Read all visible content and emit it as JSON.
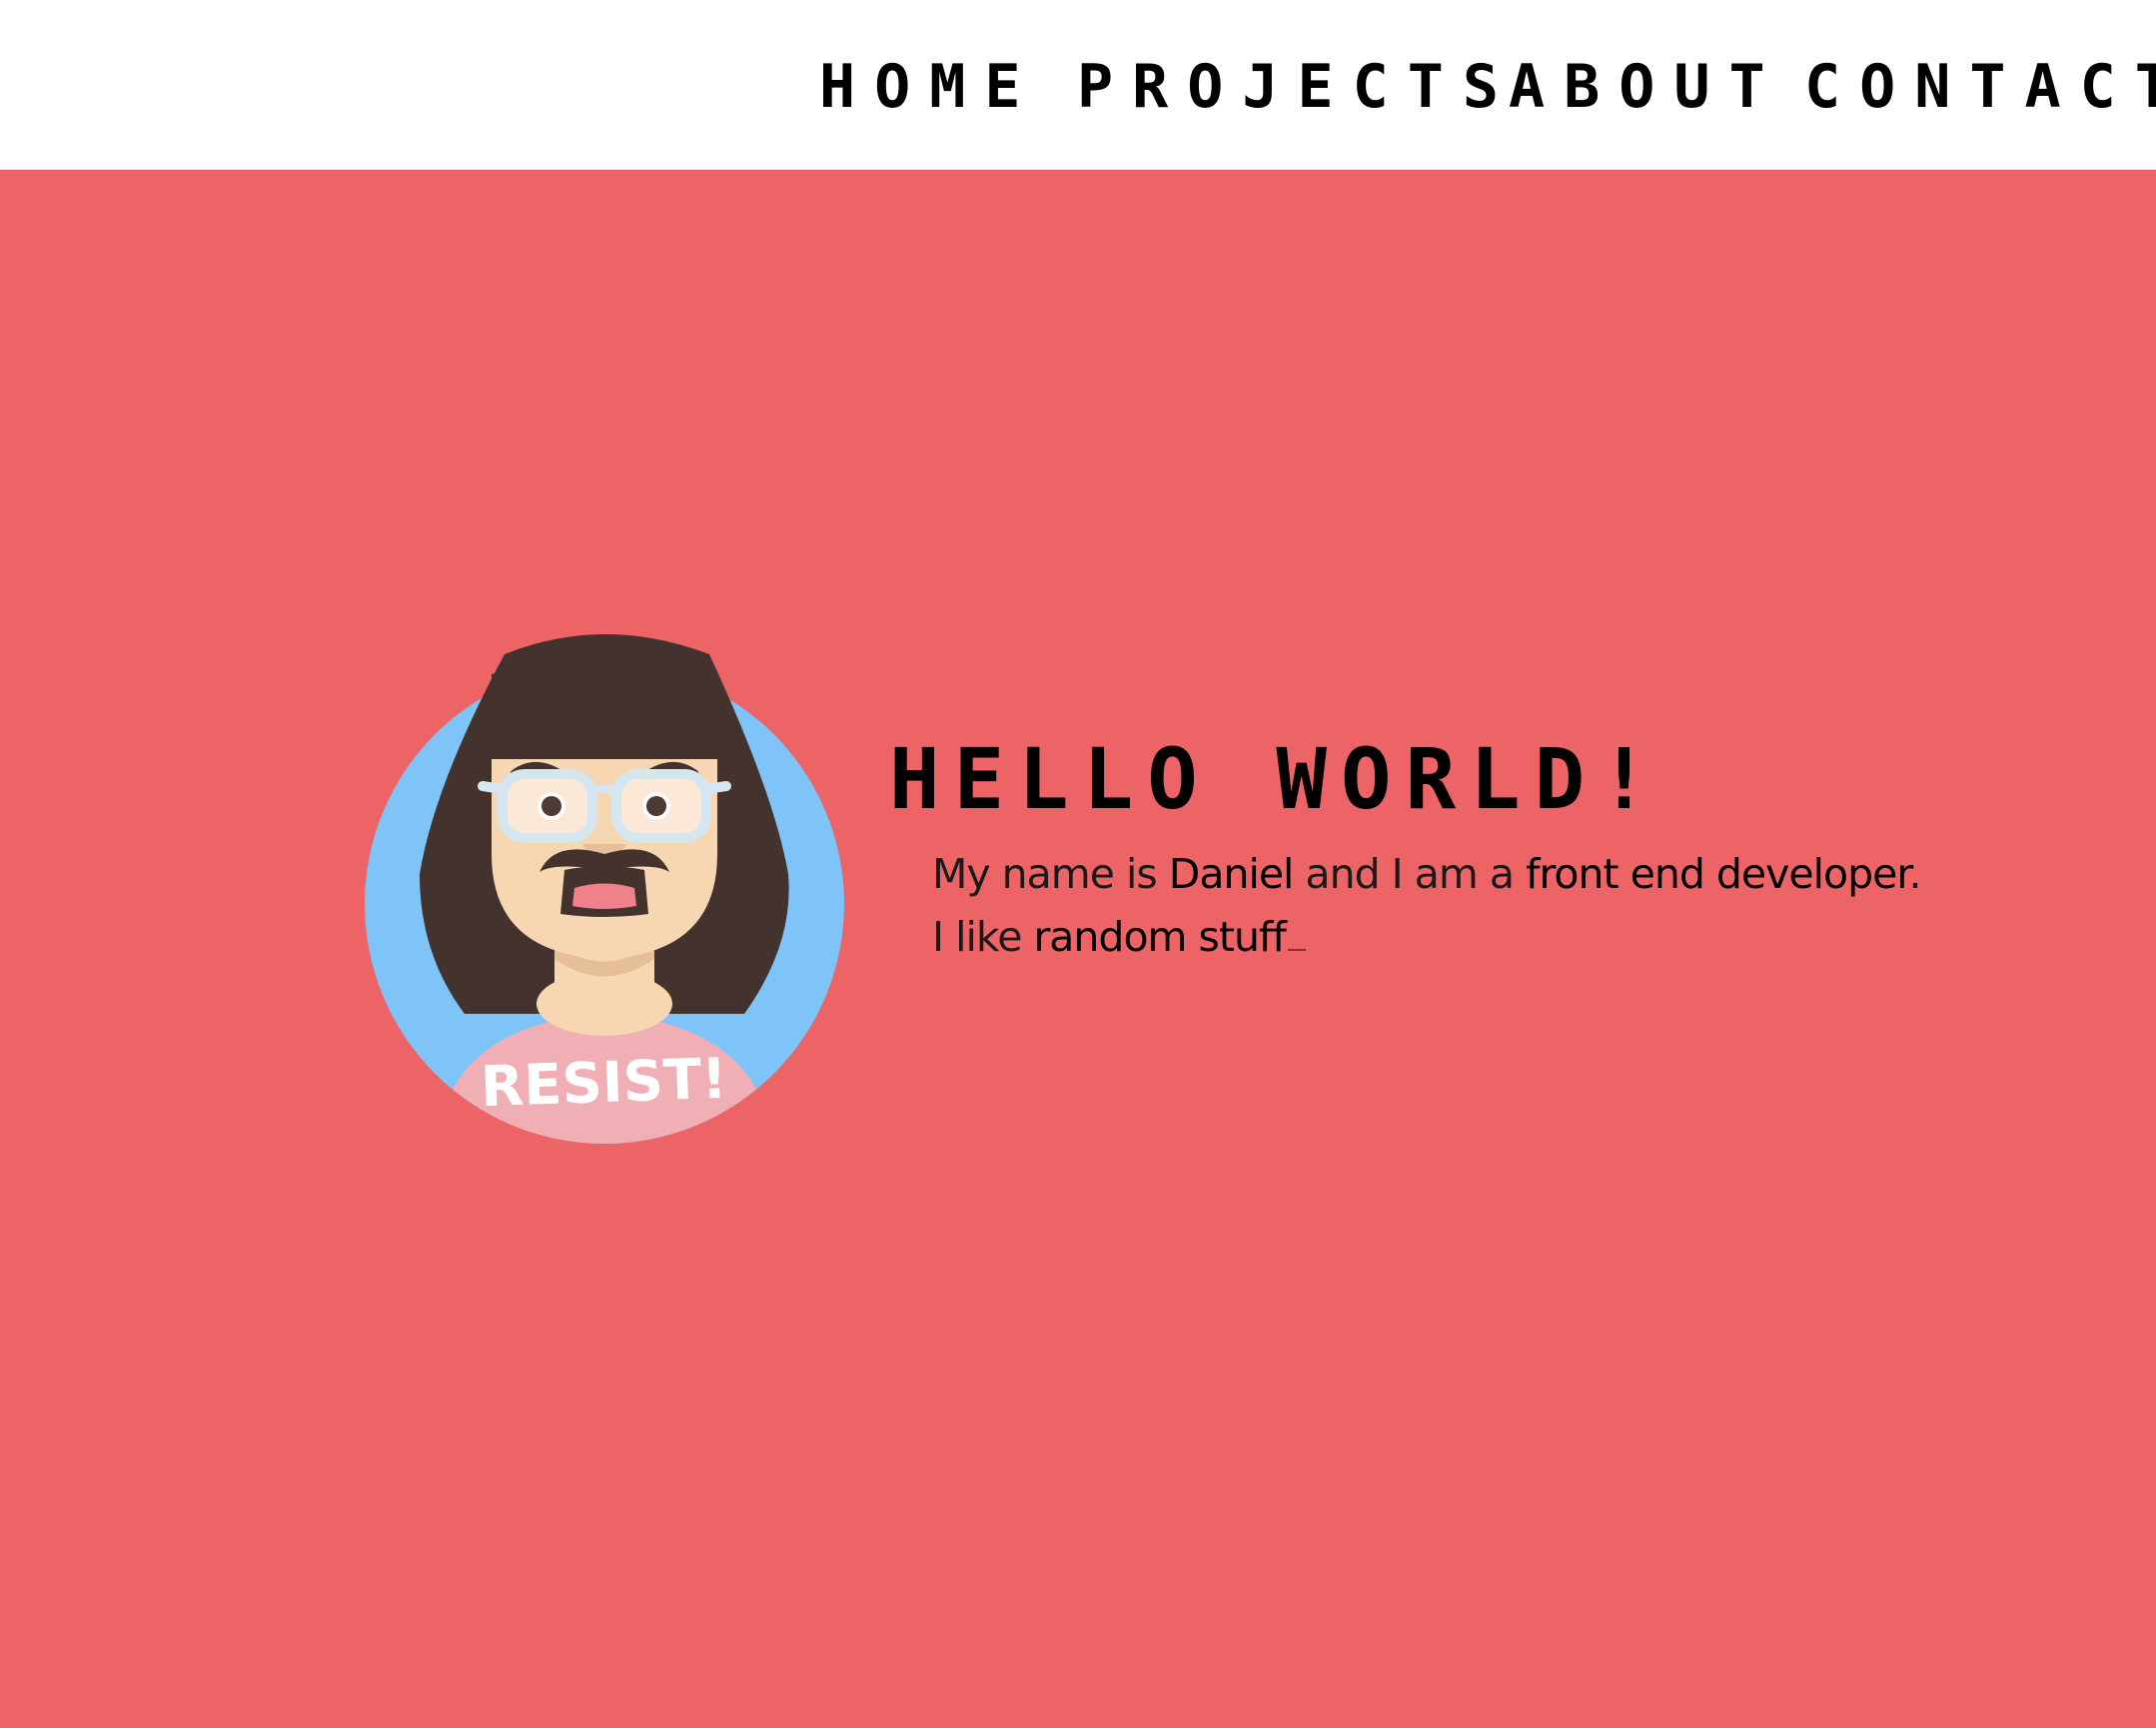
{
  "nav": {
    "items": [
      {
        "label": "HOME"
      },
      {
        "label": "PROJECTS"
      },
      {
        "label": "ABOUT"
      },
      {
        "label": "CONTACT"
      }
    ]
  },
  "hero": {
    "greeting": "HELLO WORLD!",
    "line1": {
      "part1": "My name is ",
      "name": "Daniel",
      "part2": " and I am a ",
      "role": "front end developer",
      "part3": "."
    },
    "line2": {
      "part1": "I like ",
      "interest": "random stuff"
    },
    "avatar": {
      "shirt_text": "RESIST!"
    }
  },
  "colors": {
    "background": "#ec6466",
    "header": "#ffffff",
    "avatar_circle": "#7fc4f9",
    "hair": "#43322d",
    "skin": "#f7d6b2",
    "shirt": "#f0afb5"
  }
}
